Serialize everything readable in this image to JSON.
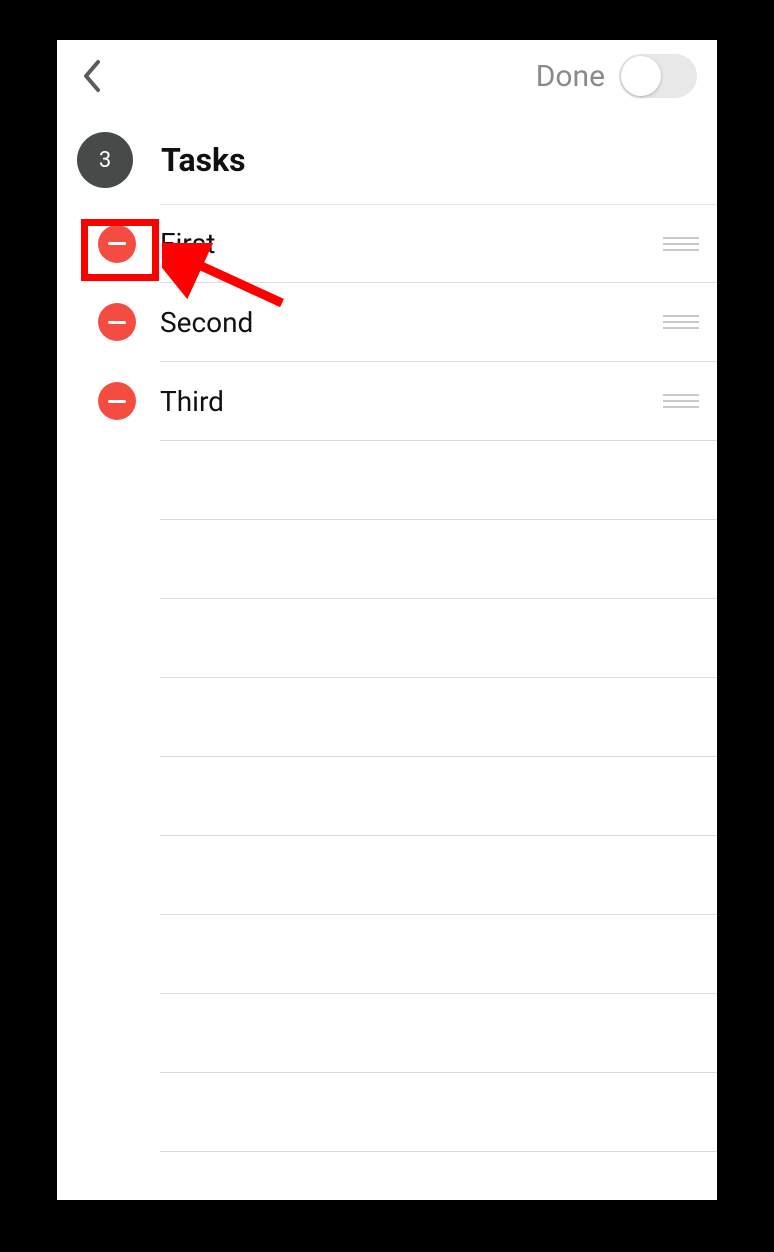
{
  "header": {
    "done_label": "Done",
    "done_toggle_on": false
  },
  "title": {
    "count": "3",
    "label": "Tasks"
  },
  "tasks": [
    {
      "label": "First"
    },
    {
      "label": "Second"
    },
    {
      "label": "Third"
    }
  ],
  "empty_rows": 10,
  "colors": {
    "delete_red": "#f44c40",
    "badge_bg": "#464b4a",
    "divider": "#dcdcdc",
    "annotation_red": "#ff0000"
  }
}
